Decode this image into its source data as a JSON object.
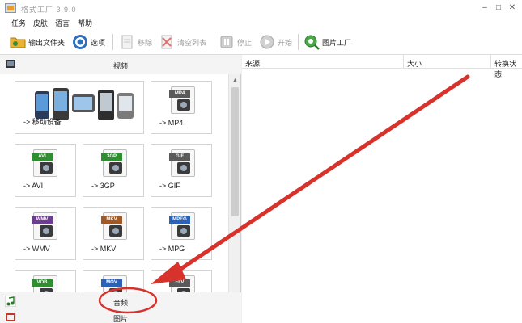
{
  "window": {
    "title": "格式工厂 3.9.0",
    "minimize_glyph": "–",
    "maximize_glyph": "□",
    "close_glyph": "✕"
  },
  "menu": [
    "任务",
    "皮肤",
    "语言",
    "帮助"
  ],
  "toolbar": {
    "output_folder": "输出文件夹",
    "options": "选项",
    "remove": "移除",
    "clear_list": "清空列表",
    "stop": "停止",
    "start": "开始",
    "picture_factory": "图片工厂"
  },
  "categories": {
    "video": "视频",
    "audio": "音频",
    "picture": "图片"
  },
  "video_tiles": [
    {
      "label": "-> 移动设备",
      "icon": "mobile-devices-icon"
    },
    {
      "label": "-> MP4",
      "badge": "MP4",
      "icon": "mp4-icon"
    },
    {
      "label": "-> AVI",
      "badge": "AVI",
      "icon": "avi-icon"
    },
    {
      "label": "-> 3GP",
      "badge": "3GP",
      "icon": "3gp-icon"
    },
    {
      "label": "-> GIF",
      "badge": "GIF",
      "icon": "gif-icon"
    },
    {
      "label": "-> WMV",
      "badge": "WMV",
      "icon": "wmv-icon"
    },
    {
      "label": "-> MKV",
      "badge": "MKV",
      "icon": "mkv-icon"
    },
    {
      "label": "-> MPG",
      "badge": "MPEG",
      "icon": "mpg-icon"
    },
    {
      "label": "",
      "badge": "VOB",
      "icon": "vob-icon"
    },
    {
      "label": "",
      "badge": "MOV",
      "icon": "mov-icon"
    },
    {
      "label": "",
      "badge": "FLV",
      "icon": "flv-icon"
    }
  ],
  "task_list": {
    "columns": [
      "来源",
      "大小",
      "转换状态"
    ]
  },
  "colors": {
    "annotation_red": "#d8322c",
    "badge_green": "#2f8f2f",
    "badge_blue": "#2a62b8",
    "badge_purple": "#6d3d8f",
    "badge_gray": "#5a5a5a"
  }
}
